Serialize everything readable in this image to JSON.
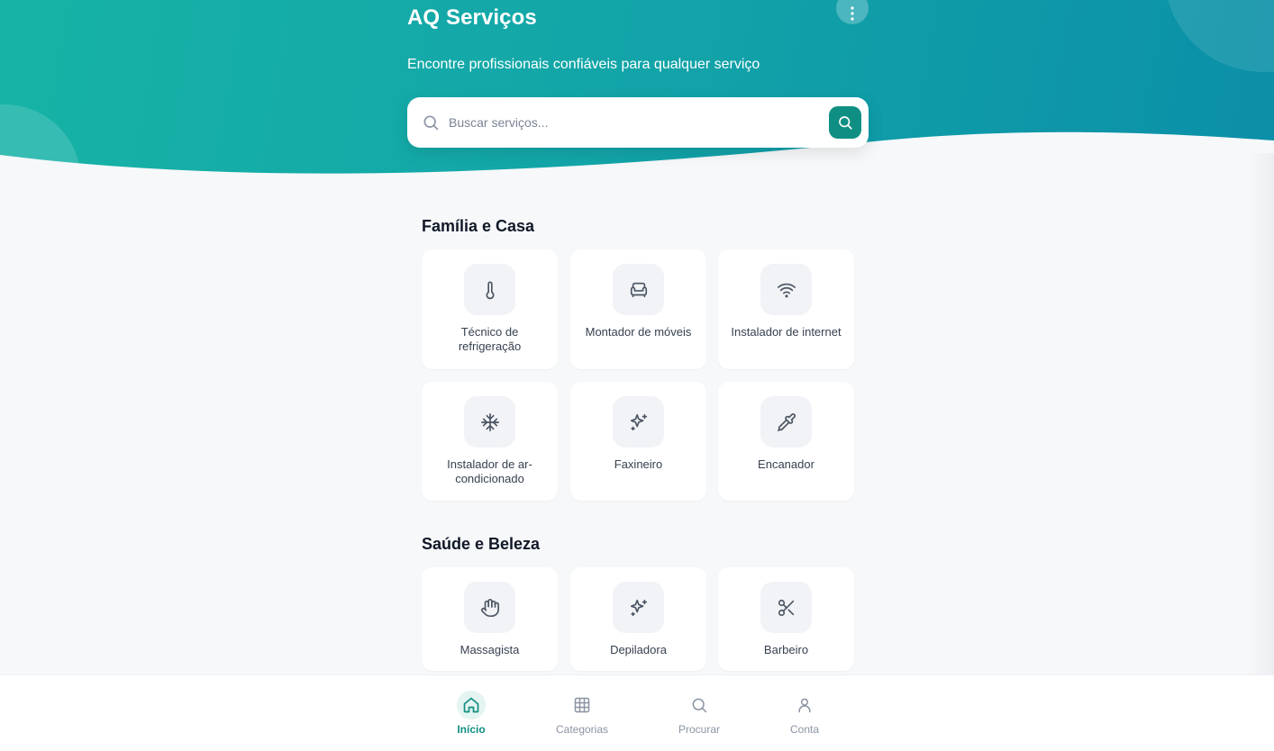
{
  "header": {
    "title": "AQ Serviços",
    "subtitle": "Encontre profissionais confiáveis para qualquer serviço",
    "menu_icon": "more-vertical-icon"
  },
  "search": {
    "placeholder": "Buscar serviços...",
    "value": "",
    "icon": "search-icon",
    "submit_icon": "search-icon"
  },
  "sections": [
    {
      "title": "Família e Casa",
      "items": [
        {
          "label": "Técnico de refrigeração",
          "icon": "thermometer-icon"
        },
        {
          "label": "Montador de móveis",
          "icon": "armchair-icon"
        },
        {
          "label": "Instalador de internet",
          "icon": "wifi-icon"
        },
        {
          "label": "Instalador de ar-condicionado",
          "icon": "snowflake-icon"
        },
        {
          "label": "Faxineiro",
          "icon": "sparkles-icon"
        },
        {
          "label": "Encanador",
          "icon": "pipette-icon"
        }
      ]
    },
    {
      "title": "Saúde e Beleza",
      "items": [
        {
          "label": "Massagista",
          "icon": "hand-icon"
        },
        {
          "label": "Depiladora",
          "icon": "sparkles-icon"
        },
        {
          "label": "Barbeiro",
          "icon": "scissors-icon"
        }
      ]
    }
  ],
  "bottom_nav": [
    {
      "label": "Início",
      "icon": "home-icon",
      "active": true
    },
    {
      "label": "Categorias",
      "icon": "grid-icon",
      "active": false
    },
    {
      "label": "Procurar",
      "icon": "search-icon",
      "active": false
    },
    {
      "label": "Conta",
      "icon": "user-icon",
      "active": false
    }
  ],
  "colors": {
    "accent": "#0f8f83",
    "header_start": "#17b3a6",
    "header_end": "#0b8fa8",
    "background": "#f6f8fa"
  }
}
